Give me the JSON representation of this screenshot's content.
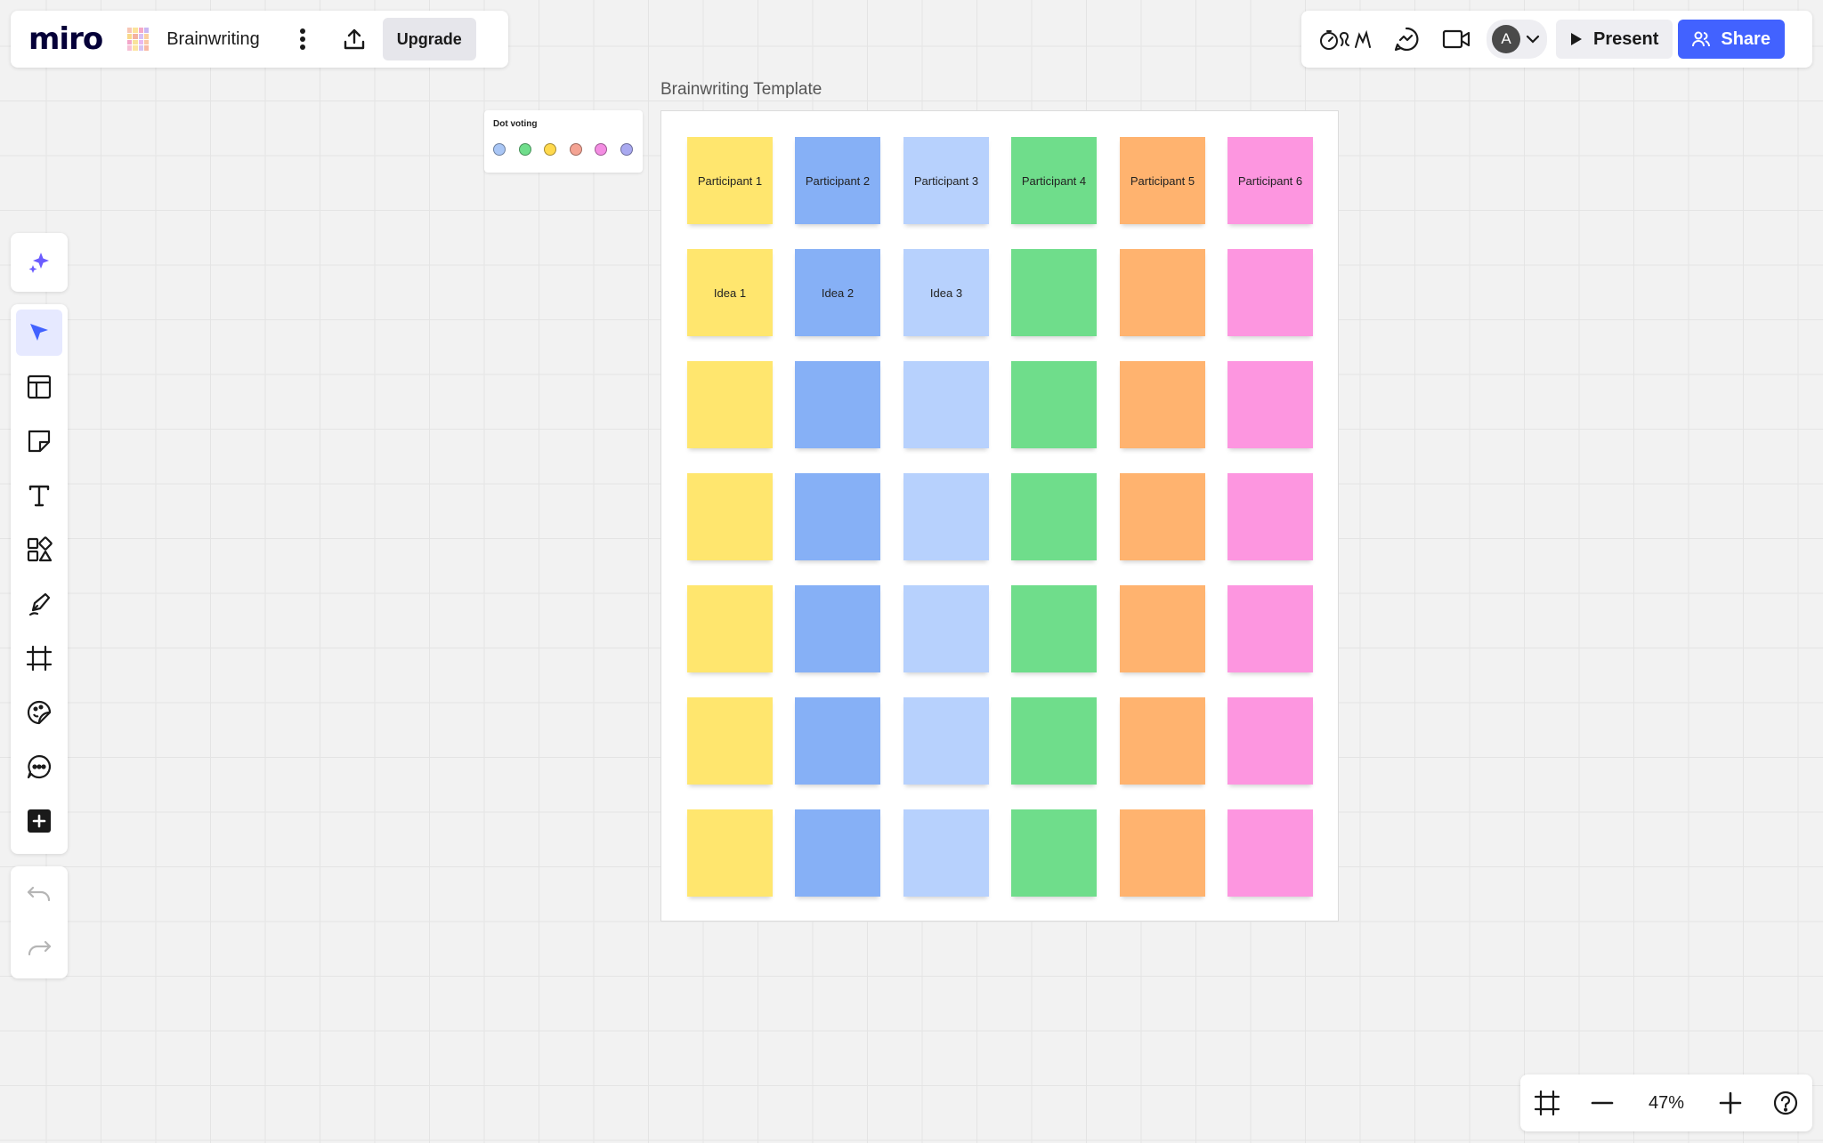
{
  "app": {
    "logo": "miro",
    "board_name": "Brainwriting",
    "upgrade_label": "Upgrade"
  },
  "header_right": {
    "avatar_initial": "A",
    "present_label": "Present",
    "share_label": "Share"
  },
  "colors": {
    "accent": "#4262ff",
    "yellow": "#ffe66e",
    "blue": "#86b0f6",
    "light_blue": "#b7d1fd",
    "green": "#6fdd8b",
    "orange": "#ffb36f",
    "pink": "#fd96e0"
  },
  "toolbar": {
    "items": [
      "ai-sparkle-icon",
      "select-cursor-icon",
      "templates-icon",
      "sticky-note-icon",
      "text-icon",
      "shapes-icon",
      "pen-icon",
      "frame-icon",
      "sticker-icon",
      "comment-icon",
      "more-apps-icon"
    ],
    "active": "select-cursor-icon"
  },
  "dot_voting": {
    "label": "Dot voting",
    "dot_colors": [
      "#a9c6f5",
      "#6fdd8b",
      "#ffd94d",
      "#f4a393",
      "#f38de2",
      "#a9a9f0"
    ]
  },
  "frame": {
    "title": "Brainwriting Template",
    "column_colors": [
      "#ffe66e",
      "#86b0f6",
      "#b7d1fd",
      "#6fdd8b",
      "#ffb36f",
      "#fd96e0"
    ],
    "rows": [
      [
        "Participant 1",
        "Participant 2",
        "Participant 3",
        "Participant 4",
        "Participant 5",
        "Participant 6"
      ],
      [
        "Idea 1",
        "Idea 2",
        "Idea 3",
        "",
        "",
        ""
      ],
      [
        "",
        "",
        "",
        "",
        "",
        ""
      ],
      [
        "",
        "",
        "",
        "",
        "",
        ""
      ],
      [
        "",
        "",
        "",
        "",
        "",
        ""
      ],
      [
        "",
        "",
        "",
        "",
        "",
        ""
      ],
      [
        "",
        "",
        "",
        "",
        "",
        ""
      ]
    ]
  },
  "zoom": {
    "level": "47%"
  }
}
